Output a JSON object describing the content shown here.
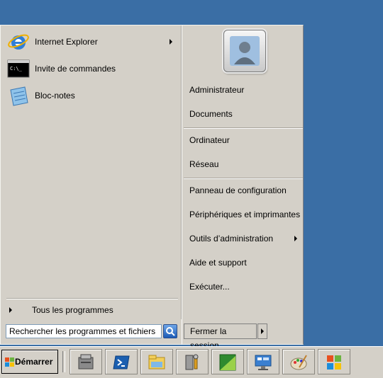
{
  "start_menu": {
    "programs": [
      {
        "label": "Internet Explorer",
        "icon": "internet-explorer-icon",
        "submenu": true
      },
      {
        "label": "Invite de commandes",
        "icon": "command-prompt-icon",
        "submenu": false
      },
      {
        "label": "Bloc-notes",
        "icon": "notepad-icon",
        "submenu": false
      }
    ],
    "all_programs": "Tous les programmes",
    "search": {
      "placeholder": "Rechercher les programmes et fichiers",
      "value": ""
    },
    "right": {
      "user_name": "Administrateur",
      "documents": "Documents",
      "computer": "Ordinateur",
      "network": "Réseau",
      "control_panel": "Panneau de configuration",
      "devices": "Périphériques et imprimantes",
      "admin_tools": "Outils d’administration",
      "help": "Aide et support",
      "run": "Exécuter..."
    },
    "shutdown": "Fermer la session"
  },
  "taskbar": {
    "start": "Démarrer",
    "pinned": [
      "server-manager-icon",
      "powershell-icon",
      "explorer-icon",
      "admin-tools-icon",
      "task-icon",
      "remote-desktop-icon",
      "paint-icon",
      "windows-icon"
    ]
  },
  "colors": {
    "desktop": "#3a6ea5",
    "menu": "#d4d0c8",
    "accent": "#1c5bb6"
  }
}
